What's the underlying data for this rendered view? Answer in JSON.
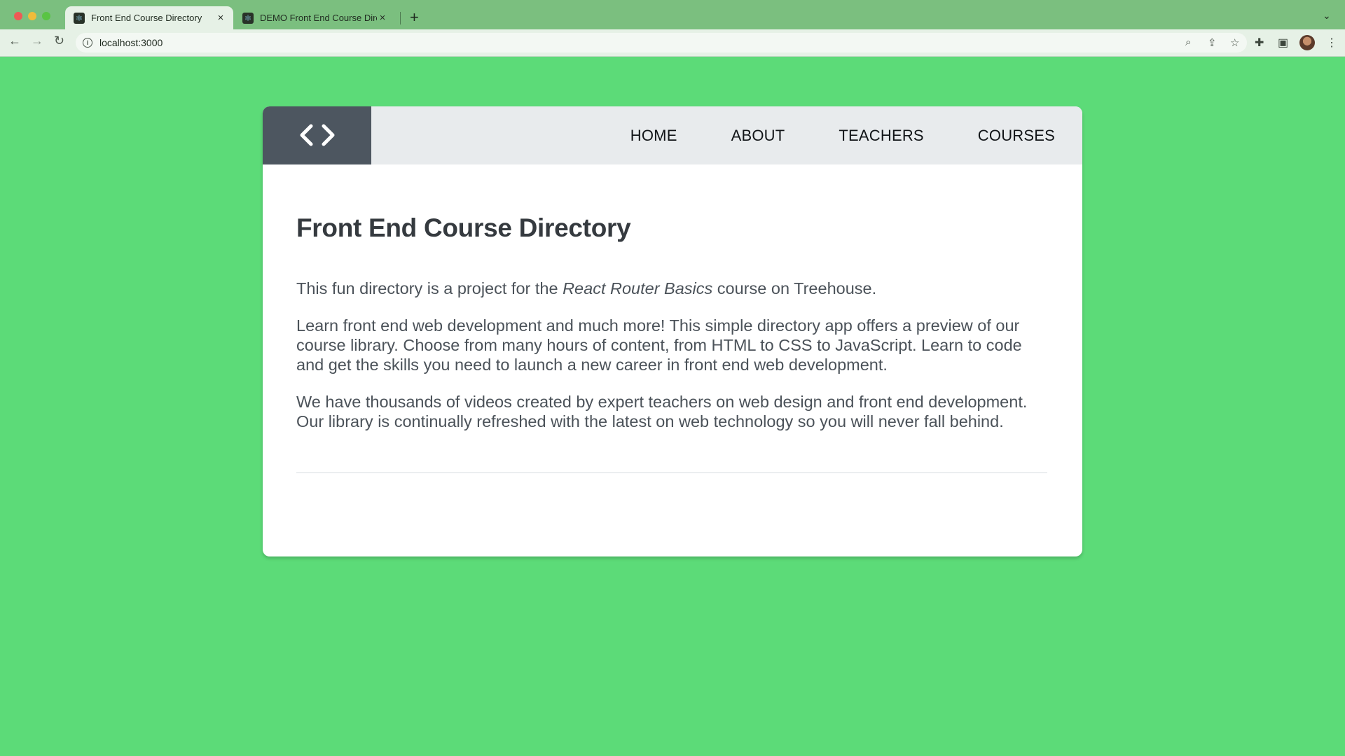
{
  "browser": {
    "tabs": [
      {
        "title": "Front End Course Directory",
        "active": true
      },
      {
        "title": "DEMO Front End Course Directory",
        "active": false
      }
    ],
    "url": "localhost:3000"
  },
  "page": {
    "nav": {
      "logo": "code-brackets-icon",
      "items": [
        "HOME",
        "ABOUT",
        "TEACHERS",
        "COURSES"
      ]
    },
    "title": "Front End Course Directory",
    "intro": {
      "before": "This fun directory is a project for the ",
      "emphasis": "React Router Basics",
      "after": " course on Treehouse."
    },
    "paragraph_2": "Learn front end web development and much more! This simple directory app offers a preview of our course library. Choose from many hours of content, from HTML to CSS to JavaScript. Learn to code and get the skills you need to launch a new career in front end web development.",
    "paragraph_3": "We have thousands of videos created by expert teachers on web design and front end development. Our library is continually refreshed with the latest on web technology so you will never fall behind."
  },
  "colors": {
    "background": "#5cdb78",
    "header": "#e8ebed",
    "logo_block": "#4d5660"
  }
}
